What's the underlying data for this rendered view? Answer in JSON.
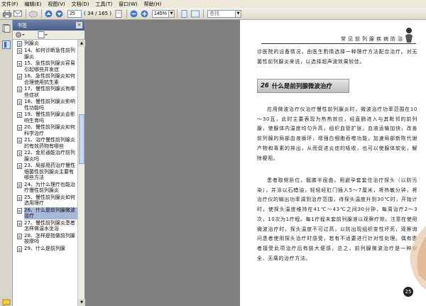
{
  "menu": [
    "文件(F)",
    "编辑(E)",
    "视图(V)",
    "文档(D)",
    "工具(T)",
    "窗口(W)",
    "帮助(H)"
  ],
  "toolbar": {
    "page_value": "25",
    "page_total": "( 34 / 165 )",
    "zoom_value": "145%",
    "search_placeholder": "查找"
  },
  "bookmarks": {
    "title": "书签",
    "close_symbol": "×",
    "items": [
      {
        "label": "列腺炎",
        "selected": false
      },
      {
        "label": "14、如何诊断急性前列腺炎",
        "selected": false
      },
      {
        "label": "15、急性前列腺炎容易引起哪些并发症",
        "selected": false
      },
      {
        "label": "16、急性前列腺炎如何合理使用抗生素",
        "selected": false
      },
      {
        "label": "17、慢性前列腺炎有哪些症状",
        "selected": false
      },
      {
        "label": "18、慢性前列腺炎影响性功能吗",
        "selected": false
      },
      {
        "label": "19、慢性前列腺炎会影响生育吗",
        "selected": false
      },
      {
        "label": "20、慢性前列腺炎如何科学治疗",
        "selected": false
      },
      {
        "label": "21、治疗慢性前列腺炎的有效药物有哪些",
        "selected": false
      },
      {
        "label": "22、金尼通能治疗前列腺炎吗",
        "selected": false
      },
      {
        "label": "23、局部用药治疗慢性细菌性前列腺炎主要有哪些方法",
        "selected": false
      },
      {
        "label": "24、为什么理疗也能治疗慢性前列腺炎",
        "selected": false
      },
      {
        "label": "25、慢性前列腺炎如何选用理疗",
        "selected": false
      },
      {
        "label": "26、什么是前列腺微波治疗",
        "selected": true
      },
      {
        "label": "27、慢性前列腺炎患者怎样做温水坐浴",
        "selected": false
      },
      {
        "label": "28、怎样是指做前列腺按摩吗",
        "selected": false
      },
      {
        "label": "29、什么是前列腺",
        "selected": false
      }
    ]
  },
  "document": {
    "running_header": "常见前列腺疾病防治",
    "intro_text": "诊医院的设备情况，由医生酌情选择一种理疗方法配合治疗。对无菌性前列腺炎来说，以选择超声波效果较佳。",
    "section_number": "26",
    "section_title": "什么是前列腺微波治疗",
    "para1": "应用微波治疗仪治疗慢性前列腺炎时，微波治疗功率范围在10～30瓦，此时主要表现为热热效应，经直肠进入与其毗邻的前列腺，使腺体内温度均匀升高，组织血管扩张，血液运输加快，改善前列腺的局部血液循环，增强白细胞吞噬功能，加速局部新陈代谢产物和毒素的排出，从而促进炎症的吸收，也可以使腺体软化，解除梗阻。",
    "para2": "患者取侧卧位，髋膝半屈曲。用避孕套套住治疗探头（以防污染），并涂以石蜡油，轻轻经肛门插入5～7厘米，将热敏分钟，将治疗仪的输出功率调到治疗范围，待探头温度升到30℃时，开始计时，使探头温度维持在41℃～43℃之间30分钟，每周治疗2～3次，10次为1疗程。每1疗程末套前列腺液以观察疗效。注意在使用微波治疗时，探头温度不可过高，以防出现组织变性坏死，观察询问患者使用探头治疗时感受，若有不适要进行针对性处理。偶有患者接受此项治疗后有肢大便感，总之，前列腺微波治疗是一种安全、无痛的治疗方法。",
    "page_number": "25"
  }
}
